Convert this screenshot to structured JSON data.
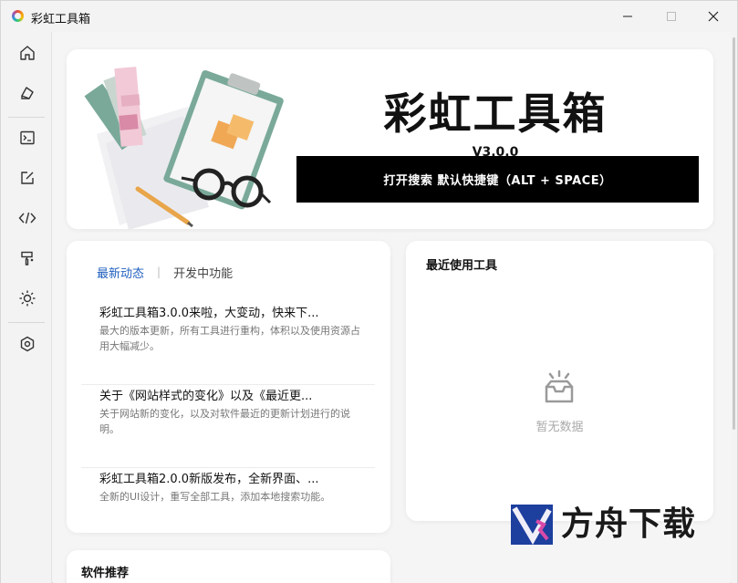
{
  "window": {
    "title": "彩虹工具箱"
  },
  "hero": {
    "title": "彩虹工具箱",
    "version": "V3.0.0",
    "search_label": "打开搜索 默认快捷键（ALT + SPACE）"
  },
  "news": {
    "tabs": [
      "最新动态",
      "开发中功能"
    ],
    "items": [
      {
        "title": "彩虹工具箱3.0.0来啦，大变动，快来下...",
        "desc": "最大的版本更新，所有工具进行重构，体积以及使用资源占用大幅减少。"
      },
      {
        "title": "关于《网站样式的变化》以及《最近更...",
        "desc": "关于网站新的变化，以及对软件最近的更新计划进行的说明。"
      },
      {
        "title": "彩虹工具箱2.0.0新版发布，全新界面、...",
        "desc": "全新的UI设计，重写全部工具，添加本地搜索功能。"
      }
    ]
  },
  "recent": {
    "title": "最近使用工具",
    "empty": "暂无数据"
  },
  "recommend": {
    "title": "软件推荐"
  },
  "watermark": {
    "text": "方舟下载"
  },
  "sidebar": {
    "icons": [
      "home-icon",
      "paint-bucket-icon",
      "terminal-icon",
      "edit-icon",
      "code-icon",
      "brush-icon",
      "sun-icon",
      "settings-icon"
    ]
  },
  "colors": {
    "accent": "#1f5fbf",
    "search_bg": "#000000"
  }
}
